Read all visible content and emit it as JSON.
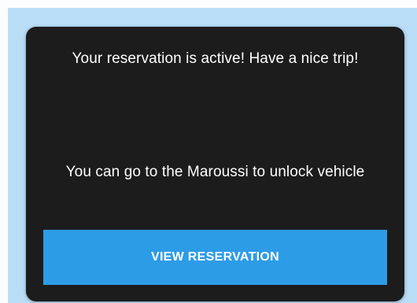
{
  "colors": {
    "backdrop": "#b9ddf7",
    "dialog_background": "#1c1c1c",
    "dialog_text": "#ffffff",
    "button_background": "#2d9ce6",
    "button_text": "#ffffff"
  },
  "dialog": {
    "message_primary": "Your reservation is active! Have a nice trip!",
    "message_secondary": "You can go to the Maroussi to unlock vehicle",
    "button_label": "VIEW RESERVATION"
  }
}
